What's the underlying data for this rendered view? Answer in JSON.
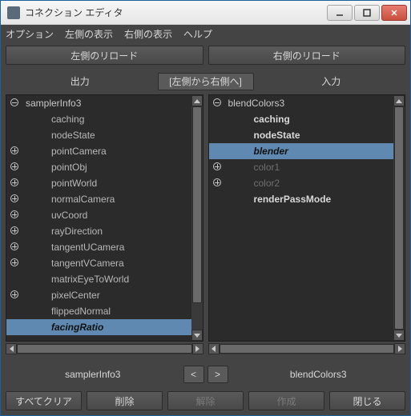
{
  "window": {
    "title": "コネクション エディタ"
  },
  "menu": {
    "options": "オプション",
    "leftView": "左側の表示",
    "rightView": "右側の表示",
    "help": "ヘルプ"
  },
  "reload": {
    "left": "左側のリロード",
    "right": "右側のリロード"
  },
  "headers": {
    "out": "出力",
    "mid": "[左側から右側へ]",
    "in": "入力"
  },
  "left": {
    "root": "samplerInfo3",
    "items": [
      {
        "label": "caching",
        "expander": "",
        "style": ""
      },
      {
        "label": "nodeState",
        "expander": "",
        "style": ""
      },
      {
        "label": "pointCamera",
        "expander": "plus",
        "style": ""
      },
      {
        "label": "pointObj",
        "expander": "plus",
        "style": ""
      },
      {
        "label": "pointWorld",
        "expander": "plus",
        "style": ""
      },
      {
        "label": "normalCamera",
        "expander": "plus",
        "style": ""
      },
      {
        "label": "uvCoord",
        "expander": "plus",
        "style": ""
      },
      {
        "label": "rayDirection",
        "expander": "plus",
        "style": ""
      },
      {
        "label": "tangentUCamera",
        "expander": "plus",
        "style": ""
      },
      {
        "label": "tangentVCamera",
        "expander": "plus",
        "style": ""
      },
      {
        "label": "matrixEyeToWorld",
        "expander": "",
        "style": ""
      },
      {
        "label": "pixelCenter",
        "expander": "plus",
        "style": ""
      },
      {
        "label": "flippedNormal",
        "expander": "",
        "style": ""
      },
      {
        "label": "facingRatio",
        "expander": "",
        "style": "sel"
      }
    ]
  },
  "right": {
    "root": "blendColors3",
    "items": [
      {
        "label": "caching",
        "expander": "",
        "style": "bold"
      },
      {
        "label": "nodeState",
        "expander": "",
        "style": "bold"
      },
      {
        "label": "blender",
        "expander": "",
        "style": "sel"
      },
      {
        "label": "color1",
        "expander": "plus",
        "style": "muted"
      },
      {
        "label": "color2",
        "expander": "plus",
        "style": "muted"
      },
      {
        "label": "renderPassMode",
        "expander": "",
        "style": "bold"
      }
    ]
  },
  "nav": {
    "leftLabel": "samplerInfo3",
    "rightLabel": "blendColors3",
    "prev": "<",
    "next": ">"
  },
  "buttons": {
    "clearAll": "すべてクリア",
    "delete": "削除",
    "remove": "解除",
    "make": "作成",
    "close": "閉じる"
  }
}
